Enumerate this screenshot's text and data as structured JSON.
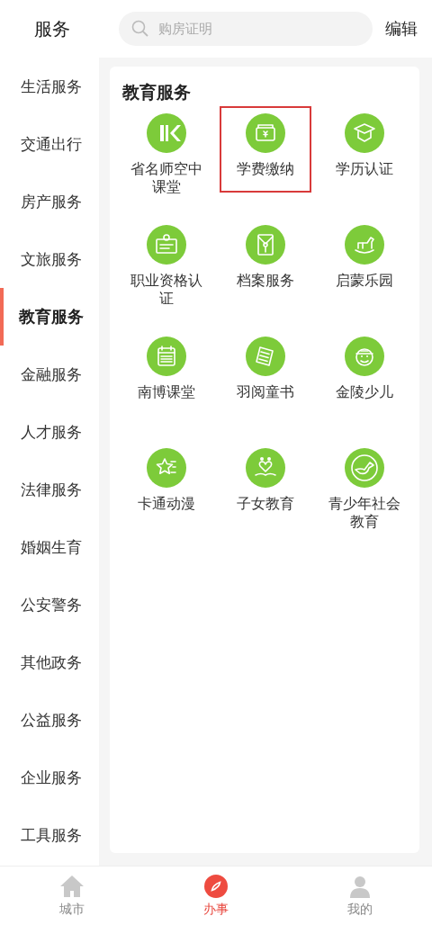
{
  "header": {
    "title": "服务",
    "search": {
      "placeholder": "购房证明"
    },
    "edit_button": "编辑"
  },
  "sidebar": {
    "items": [
      {
        "label": "生活服务",
        "selected": false
      },
      {
        "label": "交通出行",
        "selected": false
      },
      {
        "label": "房产服务",
        "selected": false
      },
      {
        "label": "文旅服务",
        "selected": false
      },
      {
        "label": "教育服务",
        "selected": true
      },
      {
        "label": "金融服务",
        "selected": false
      },
      {
        "label": "人才服务",
        "selected": false
      },
      {
        "label": "法律服务",
        "selected": false
      },
      {
        "label": "婚姻生育",
        "selected": false
      },
      {
        "label": "公安警务",
        "selected": false
      },
      {
        "label": "其他政务",
        "selected": false
      },
      {
        "label": "公益服务",
        "selected": false
      },
      {
        "label": "企业服务",
        "selected": false
      },
      {
        "label": "工具服务",
        "selected": false
      }
    ]
  },
  "section": {
    "title": "教育服务",
    "services": [
      {
        "label": "省名师空中课堂",
        "highlighted": false
      },
      {
        "label": "学费缴纳",
        "highlighted": true
      },
      {
        "label": "学历认证",
        "highlighted": false
      },
      {
        "label": "职业资格认证",
        "highlighted": false
      },
      {
        "label": "档案服务",
        "highlighted": false
      },
      {
        "label": "启蒙乐园",
        "highlighted": false
      },
      {
        "label": "南博课堂",
        "highlighted": false
      },
      {
        "label": "羽阅童书",
        "highlighted": false
      },
      {
        "label": "金陵少儿",
        "highlighted": false
      },
      {
        "label": "卡通动漫",
        "highlighted": false
      },
      {
        "label": "子女教育",
        "highlighted": false
      },
      {
        "label": "青少年社会教育",
        "highlighted": false
      }
    ]
  },
  "tab_bar": [
    {
      "label": "城市",
      "selected": false
    },
    {
      "label": "办事",
      "selected": true
    },
    {
      "label": "我的",
      "selected": false
    }
  ]
}
